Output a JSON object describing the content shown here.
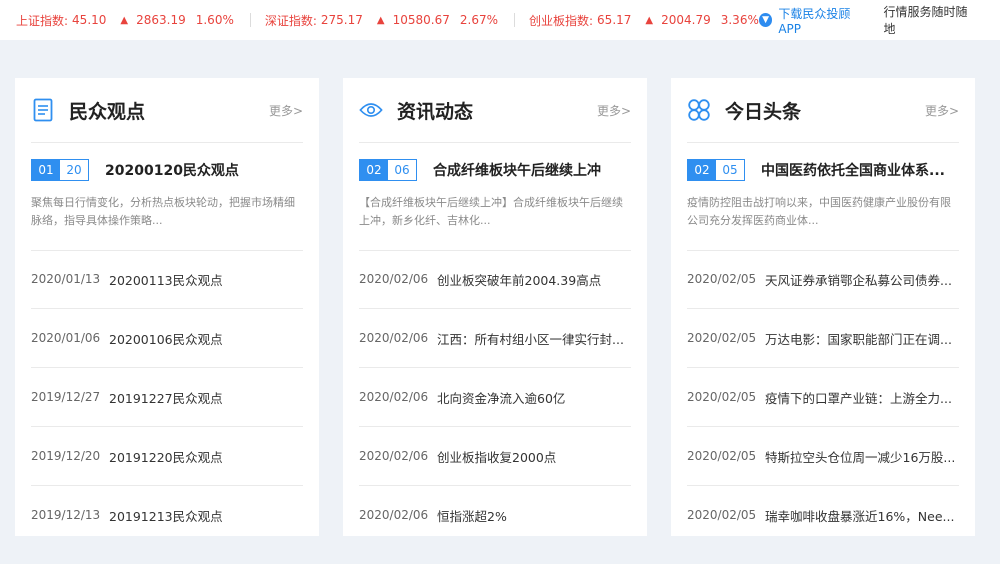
{
  "ticker": {
    "indices": [
      {
        "name": "上证指数:",
        "value": "45.10",
        "close": "2863.19",
        "pct": "1.60%"
      },
      {
        "name": "深证指数:",
        "value": "275.17",
        "close": "10580.67",
        "pct": "2.67%"
      },
      {
        "name": "创业板指数:",
        "value": "65.17",
        "close": "2004.79",
        "pct": "3.36%"
      }
    ],
    "download_label": "下载民众投顾APP",
    "service_label": "行情服务随时随地",
    "up_color": "#e8433d",
    "link_color": "#1a82e6"
  },
  "cards": [
    {
      "title": "民众观点",
      "icon": "document-icon",
      "more": "更多>",
      "featured": {
        "month": "01",
        "day": "20",
        "title": "20200120民众观点",
        "desc": "聚焦每日行情变化，分析热点板块轮动，把握市场精细脉络，指导具体操作策略..."
      },
      "items": [
        {
          "date": "2020/01/13",
          "title": "20200113民众观点"
        },
        {
          "date": "2020/01/06",
          "title": "20200106民众观点"
        },
        {
          "date": "2019/12/27",
          "title": "20191227民众观点"
        },
        {
          "date": "2019/12/20",
          "title": "20191220民众观点"
        },
        {
          "date": "2019/12/13",
          "title": "20191213民众观点"
        }
      ]
    },
    {
      "title": "资讯动态",
      "icon": "eye-icon",
      "more": "更多>",
      "featured": {
        "month": "02",
        "day": "06",
        "title": "合成纤维板块午后继续上冲",
        "desc": "【合成纤维板块午后继续上冲】合成纤维板块午后继续上冲，新乡化纤、吉林化..."
      },
      "items": [
        {
          "date": "2020/02/06",
          "title": "创业板突破年前2004.39高点"
        },
        {
          "date": "2020/02/06",
          "title": "江西：所有村组小区一律实行封..."
        },
        {
          "date": "2020/02/06",
          "title": "北向资金净流入逾60亿"
        },
        {
          "date": "2020/02/06",
          "title": "创业板指收复2000点"
        },
        {
          "date": "2020/02/06",
          "title": "恒指涨超2%"
        }
      ]
    },
    {
      "title": "今日头条",
      "icon": "clover-icon",
      "more": "更多>",
      "featured": {
        "month": "02",
        "day": "05",
        "title": "中国医药依托全国商业体系...",
        "desc": "疫情防控阻击战打响以来，中国医药健康产业股份有限公司充分发挥医药商业体..."
      },
      "items": [
        {
          "date": "2020/02/05",
          "title": "天风证券承销鄂企私募公司债券..."
        },
        {
          "date": "2020/02/05",
          "title": "万达电影：国家职能部门正在调..."
        },
        {
          "date": "2020/02/05",
          "title": "疫情下的口罩产业链：上游全力..."
        },
        {
          "date": "2020/02/05",
          "title": "特斯拉空头仓位周一减少16万股..."
        },
        {
          "date": "2020/02/05",
          "title": "瑞幸咖啡收盘暴涨近16%，Nee..."
        }
      ]
    }
  ]
}
